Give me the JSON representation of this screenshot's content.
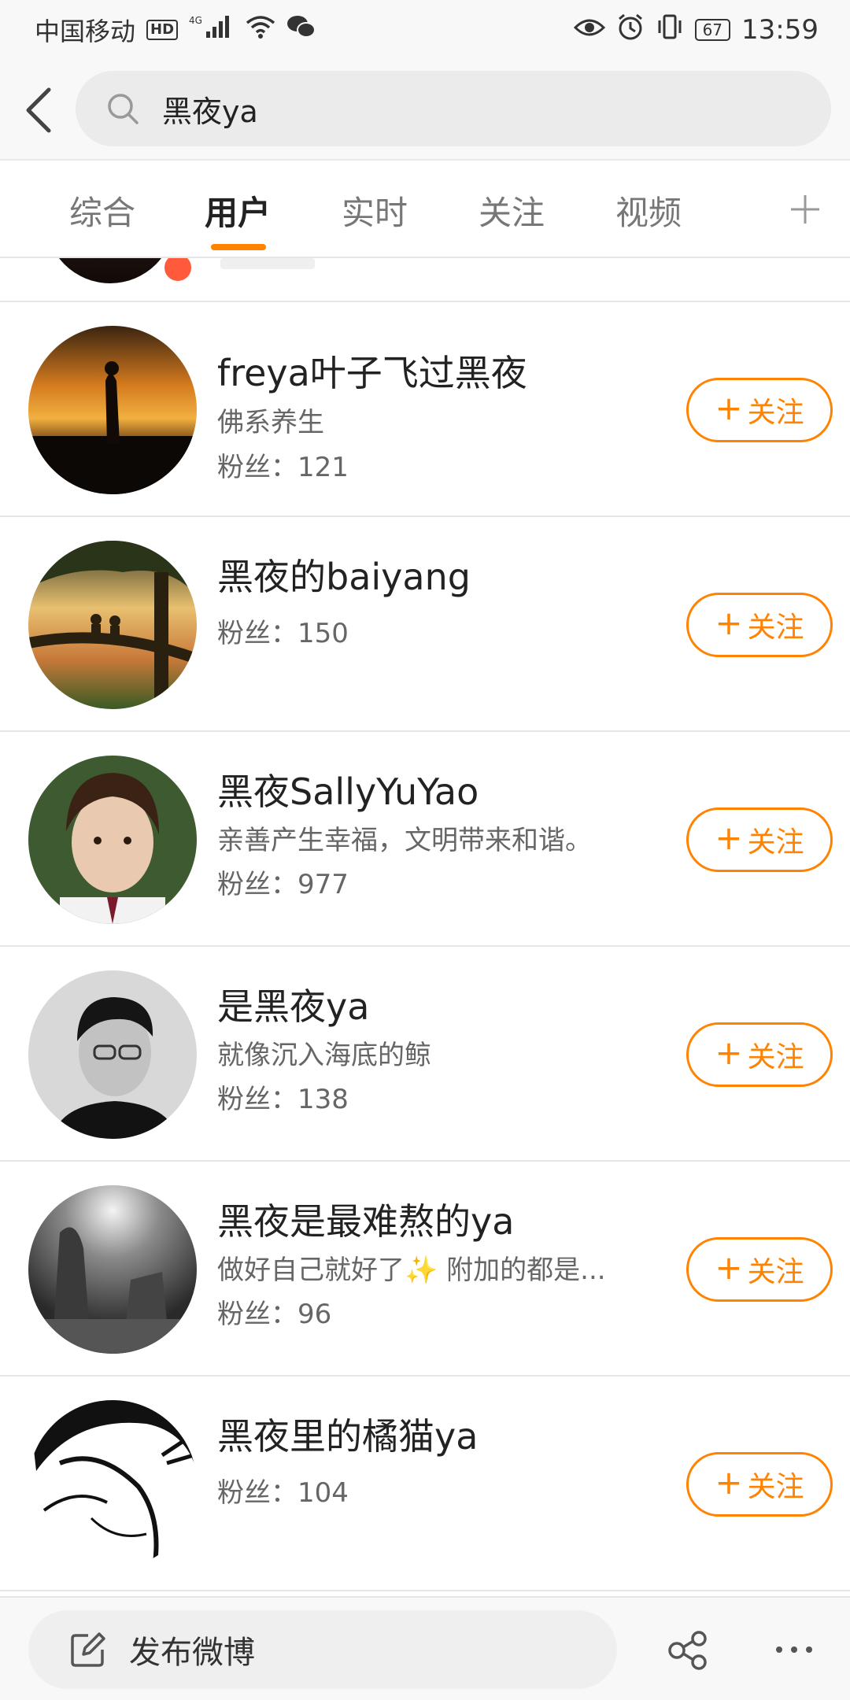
{
  "status_bar": {
    "carrier": "中国移动",
    "hd": "HD",
    "network": "4G",
    "battery": "67",
    "time": "13:59"
  },
  "search": {
    "query": "黑夜ya"
  },
  "tabs": [
    {
      "label": "综合",
      "active": false
    },
    {
      "label": "用户",
      "active": true
    },
    {
      "label": "实时",
      "active": false
    },
    {
      "label": "关注",
      "active": false
    },
    {
      "label": "视频",
      "active": false
    }
  ],
  "follow_label": "关注",
  "fans_prefix": "粉丝：",
  "users": [
    {
      "name": "freya叶子飞过黑夜",
      "bio": "佛系养生",
      "fans": "121"
    },
    {
      "name": "黑夜的baiyang",
      "bio": "",
      "fans": "150"
    },
    {
      "name": "黑夜SallyYuYao",
      "bio": "亲善产生幸福，文明带来和谐。",
      "fans": "977"
    },
    {
      "name": "是黑夜ya",
      "bio": "就像沉入海底的鲸",
      "fans": "138"
    },
    {
      "name": "黑夜是最难熬的ya",
      "bio": "做好自己就好了✨ 附加的都是...",
      "fans": "96"
    },
    {
      "name": "黑夜里的橘猫ya",
      "bio": "",
      "fans": "104"
    }
  ],
  "bottom": {
    "compose_label": "发布微博"
  },
  "colors": {
    "accent": "#ff8200"
  }
}
